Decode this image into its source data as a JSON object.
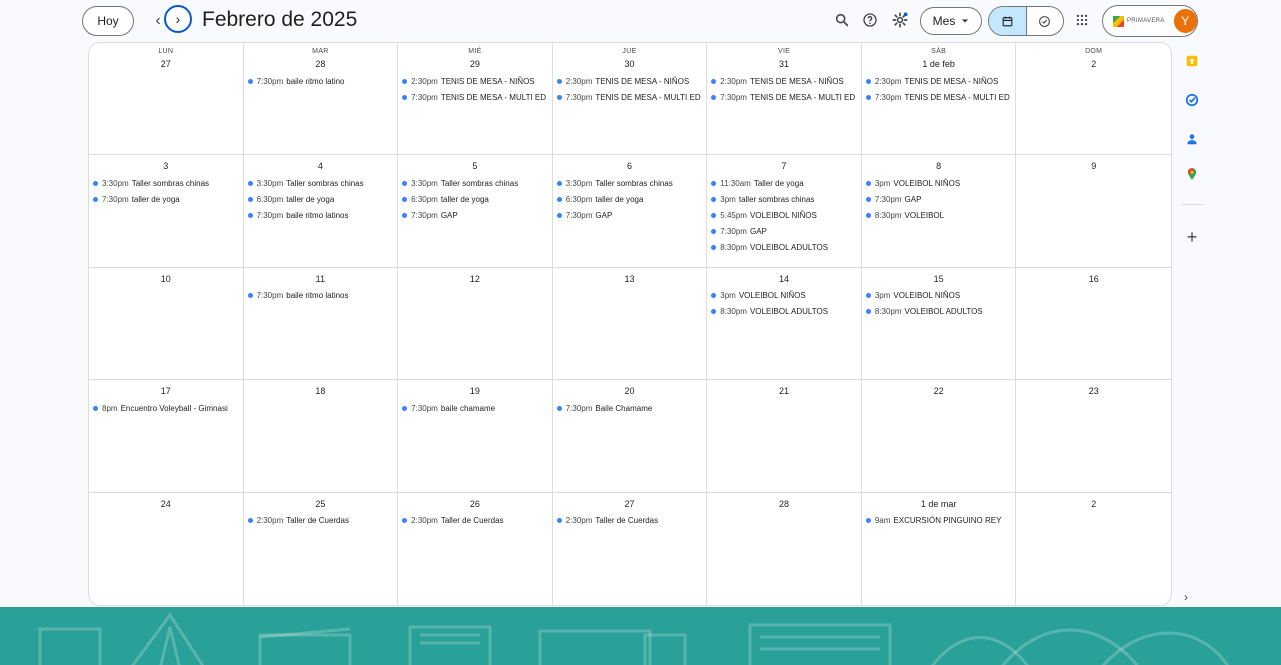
{
  "header": {
    "today_label": "Hoy",
    "prev_glyph": "‹",
    "next_glyph": "›",
    "title": "Febrero de 2025",
    "view_label": "Mes",
    "avatar_initial": "Y",
    "brand_text": "PRIMAVERA"
  },
  "weekdays": [
    "LUN",
    "MAR",
    "MIÉ",
    "JUE",
    "VIE",
    "SÁB",
    "DOM"
  ],
  "weeks": [
    [
      {
        "day": "27",
        "events": []
      },
      {
        "day": "28",
        "events": [
          {
            "time": "7:30pm",
            "title": "baile ritmo latino"
          }
        ]
      },
      {
        "day": "29",
        "events": [
          {
            "time": "2:30pm",
            "title": "TENIS DE MESA - NIÑOS"
          },
          {
            "time": "7:30pm",
            "title": "TENIS DE MESA - MULTI ED"
          }
        ]
      },
      {
        "day": "30",
        "events": [
          {
            "time": "2:30pm",
            "title": "TENIS DE MESA - NIÑOS"
          },
          {
            "time": "7:30pm",
            "title": "TENIS DE MESA - MULTI ED"
          }
        ]
      },
      {
        "day": "31",
        "events": [
          {
            "time": "2:30pm",
            "title": "TENIS DE MESA - NIÑOS"
          },
          {
            "time": "7:30pm",
            "title": "TENIS DE MESA - MULTI ED"
          }
        ]
      },
      {
        "day": "1 de feb",
        "events": [
          {
            "time": "2:30pm",
            "title": "TENIS DE MESA - NIÑOS"
          },
          {
            "time": "7:30pm",
            "title": "TENIS DE MESA - MULTI ED"
          }
        ]
      },
      {
        "day": "2",
        "events": []
      }
    ],
    [
      {
        "day": "3",
        "events": [
          {
            "time": "3:30pm",
            "title": "Taller sombras chinas"
          },
          {
            "time": "7:30pm",
            "title": "taller de yoga"
          }
        ]
      },
      {
        "day": "4",
        "events": [
          {
            "time": "3:30pm",
            "title": "Taller sombras chinas"
          },
          {
            "time": "6:30pm",
            "title": "taller de yoga"
          },
          {
            "time": "7:30pm",
            "title": "baile ritmo latinos"
          }
        ]
      },
      {
        "day": "5",
        "events": [
          {
            "time": "3:30pm",
            "title": "Taller sombras chinas"
          },
          {
            "time": "6:30pm",
            "title": "taller de yoga"
          },
          {
            "time": "7:30pm",
            "title": "GAP"
          }
        ]
      },
      {
        "day": "6",
        "events": [
          {
            "time": "3:30pm",
            "title": "Taller sombras chinas"
          },
          {
            "time": "6:30pm",
            "title": "taller de yoga"
          },
          {
            "time": "7:30pm",
            "title": "GAP"
          }
        ]
      },
      {
        "day": "7",
        "events": [
          {
            "time": "11:30am",
            "title": "Taller de yoga"
          },
          {
            "time": "3pm",
            "title": "taller sombras chinas"
          },
          {
            "time": "5:45pm",
            "title": "VOLEIBOL NIÑOS"
          },
          {
            "time": "7:30pm",
            "title": "GAP"
          },
          {
            "time": "8:30pm",
            "title": "VOLEIBOL ADULTOS"
          }
        ]
      },
      {
        "day": "8",
        "events": [
          {
            "time": "3pm",
            "title": "VOLEIBOL NIÑOS"
          },
          {
            "time": "7:30pm",
            "title": "GAP"
          },
          {
            "time": "8:30pm",
            "title": "VOLEIBOL"
          }
        ]
      },
      {
        "day": "9",
        "events": []
      }
    ],
    [
      {
        "day": "10",
        "events": []
      },
      {
        "day": "11",
        "events": [
          {
            "time": "7:30pm",
            "title": "baile ritmo latinos"
          }
        ]
      },
      {
        "day": "12",
        "events": []
      },
      {
        "day": "13",
        "events": []
      },
      {
        "day": "14",
        "events": [
          {
            "time": "3pm",
            "title": "VOLEIBOL NIÑOS"
          },
          {
            "time": "8:30pm",
            "title": "VOLEIBOL ADULTOS"
          }
        ]
      },
      {
        "day": "15",
        "events": [
          {
            "time": "3pm",
            "title": "VOLEIBOL NIÑOS"
          },
          {
            "time": "8:30pm",
            "title": "VOLEIBOL ADULTOS"
          }
        ]
      },
      {
        "day": "16",
        "events": []
      }
    ],
    [
      {
        "day": "17",
        "events": [
          {
            "time": "8pm",
            "title": "Encuentro Voleyball - Gimnasi"
          }
        ]
      },
      {
        "day": "18",
        "events": []
      },
      {
        "day": "19",
        "events": [
          {
            "time": "7:30pm",
            "title": "baile chamame"
          }
        ]
      },
      {
        "day": "20",
        "events": [
          {
            "time": "7:30pm",
            "title": "Baile Chamame"
          }
        ]
      },
      {
        "day": "21",
        "events": []
      },
      {
        "day": "22",
        "events": []
      },
      {
        "day": "23",
        "events": []
      }
    ],
    [
      {
        "day": "24",
        "events": []
      },
      {
        "day": "25",
        "events": [
          {
            "time": "2:30pm",
            "title": "Taller de Cuerdas"
          }
        ]
      },
      {
        "day": "26",
        "events": [
          {
            "time": "2:30pm",
            "title": "Taller de Cuerdas"
          }
        ]
      },
      {
        "day": "27",
        "events": [
          {
            "time": "2:30pm",
            "title": "Taller de Cuerdas"
          }
        ]
      },
      {
        "day": "28",
        "events": []
      },
      {
        "day": "1 de mar",
        "events": [
          {
            "time": "9am",
            "title": "EXCURSIÓN PINGUINO REY"
          }
        ]
      },
      {
        "day": "2",
        "events": []
      }
    ]
  ],
  "side_panel": {
    "icons": [
      "keep-icon",
      "tasks-icon",
      "contacts-icon",
      "maps-icon"
    ],
    "add_glyph": "+",
    "expand_glyph": "›"
  },
  "colors": {
    "accent": "#0b57d0",
    "event_dot": "#3b82f6",
    "banner": "#2aa198",
    "avatar": "#e8710a",
    "active_view": "#c2e7ff"
  }
}
